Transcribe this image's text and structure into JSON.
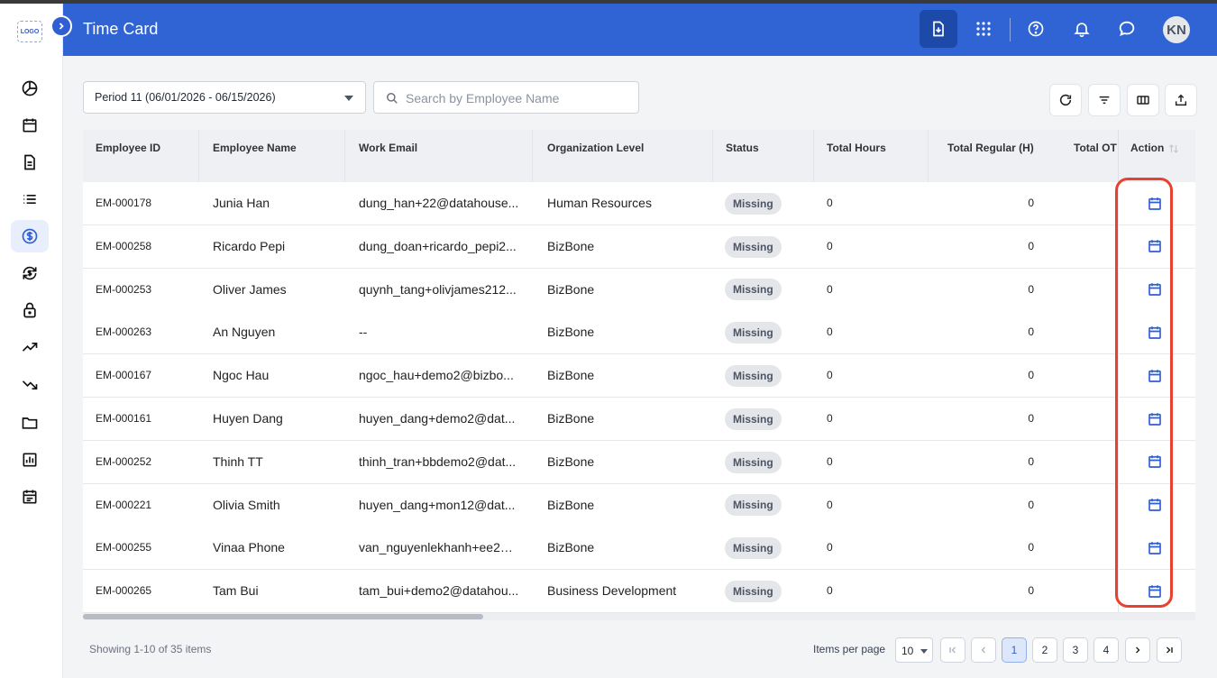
{
  "app": {
    "logo_text": "LOGO",
    "title": "Time Card",
    "avatar_initials": "KN"
  },
  "colors": {
    "header": "#3064d4",
    "accent": "#2f5fd0",
    "highlight": "#e8412f"
  },
  "sidebar": {
    "items": [
      {
        "icon": "pie-chart-icon"
      },
      {
        "icon": "calendar-icon"
      },
      {
        "icon": "document-icon"
      },
      {
        "icon": "list-icon"
      },
      {
        "icon": "dollar-icon",
        "active": true
      },
      {
        "icon": "dollar-sync-icon"
      },
      {
        "icon": "lock-icon"
      },
      {
        "icon": "trending-up-icon"
      },
      {
        "icon": "trending-down-icon"
      },
      {
        "icon": "folder-icon"
      },
      {
        "icon": "report-icon"
      },
      {
        "icon": "schedule-icon"
      }
    ]
  },
  "header": {
    "icons": [
      "download-icon",
      "apps-grid-icon",
      "help-icon",
      "bell-icon",
      "chat-icon"
    ]
  },
  "filters": {
    "period_value": "Period 11 (06/01/2026 - 06/15/2026)",
    "search_placeholder": "Search by Employee Name",
    "search_value": "",
    "toolbar_icons": [
      "refresh-icon",
      "filter-icon",
      "columns-icon",
      "export-icon"
    ]
  },
  "table": {
    "columns": [
      "Employee ID",
      "Employee Name",
      "Work Email",
      "Organization Level",
      "Status",
      "Total Hours",
      "Total Regular (H)",
      "Total OT",
      "Action"
    ],
    "rows": [
      {
        "id": "EM-000178",
        "name": "Junia Han",
        "email": "dung_han+22@datahouse...",
        "org": "Human Resources",
        "status": "Missing",
        "hours": "0",
        "regular": "0"
      },
      {
        "id": "EM-000258",
        "name": "Ricardo Pepi",
        "email": "dung_doan+ricardo_pepi2...",
        "org": "BizBone",
        "status": "Missing",
        "hours": "0",
        "regular": "0"
      },
      {
        "id": "EM-000253",
        "name": "Oliver James",
        "email": "quynh_tang+olivjames212...",
        "org": "BizBone",
        "status": "Missing",
        "hours": "0",
        "regular": "0"
      },
      {
        "id": "EM-000263",
        "name": "An Nguyen",
        "email": "--",
        "org": "BizBone",
        "status": "Missing",
        "hours": "0",
        "regular": "0"
      },
      {
        "id": "EM-000167",
        "name": "Ngoc Hau",
        "email": "ngoc_hau+demo2@bizbo...",
        "org": "BizBone",
        "status": "Missing",
        "hours": "0",
        "regular": "0"
      },
      {
        "id": "EM-000161",
        "name": "Huyen Dang",
        "email": "huyen_dang+demo2@dat...",
        "org": "BizBone",
        "status": "Missing",
        "hours": "0",
        "regular": "0"
      },
      {
        "id": "EM-000252",
        "name": "Thinh TT",
        "email": "thinh_tran+bbdemo2@dat...",
        "org": "BizBone",
        "status": "Missing",
        "hours": "0",
        "regular": "0"
      },
      {
        "id": "EM-000221",
        "name": "Olivia Smith",
        "email": "huyen_dang+mon12@dat...",
        "org": "BizBone",
        "status": "Missing",
        "hours": "0",
        "regular": "0"
      },
      {
        "id": "EM-000255",
        "name": "Vinaa Phone",
        "email": "van_nguyenlekhanh+ee2@...",
        "org": "BizBone",
        "status": "Missing",
        "hours": "0",
        "regular": "0"
      },
      {
        "id": "EM-000265",
        "name": "Tam Bui",
        "email": "tam_bui+demo2@datahou...",
        "org": "Business Development",
        "status": "Missing",
        "hours": "0",
        "regular": "0"
      }
    ]
  },
  "pagination": {
    "showing_text": "Showing 1-10 of 35 items",
    "items_per_page_label": "Items per page",
    "items_per_page_value": "10",
    "pages": [
      "1",
      "2",
      "3",
      "4"
    ],
    "current_page": "1"
  }
}
